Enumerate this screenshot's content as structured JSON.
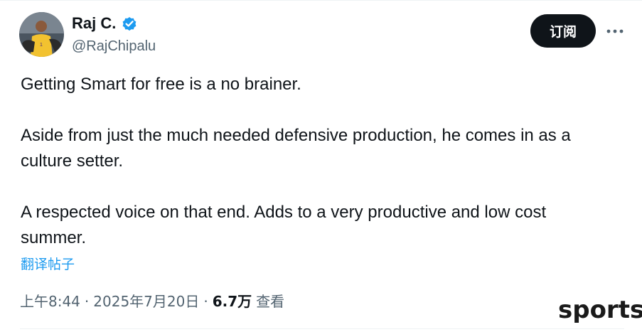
{
  "author": {
    "display_name": "Raj C.",
    "handle": "@RajChipalu",
    "verified_icon": "verified-badge-icon",
    "avatar_icon": "avatar"
  },
  "actions": {
    "subscribe_label": "订阅",
    "more_icon": "more-options-icon"
  },
  "tweet": {
    "paragraph_1": "Getting Smart for free is a no brainer.",
    "paragraph_2_line_1": "Aside from just the much needed defensive production, he comes in as a",
    "paragraph_2_line_2": "culture setter.",
    "paragraph_3_line_1": "A respected voice on that end. Adds to a very productive and low cost",
    "paragraph_3_line_2": "summer.",
    "translate_label": "翻译帖子"
  },
  "meta": {
    "time": "上午8:44",
    "separator": "·",
    "date": "2025年7月20日",
    "views_count": "6.7万",
    "views_label": "查看"
  },
  "watermark": "sports",
  "colors": {
    "text_primary": "#0f1419",
    "text_secondary": "#536471",
    "link": "#1d9bf0",
    "verified": "#1d9bf0",
    "button_bg": "#0f1419"
  }
}
